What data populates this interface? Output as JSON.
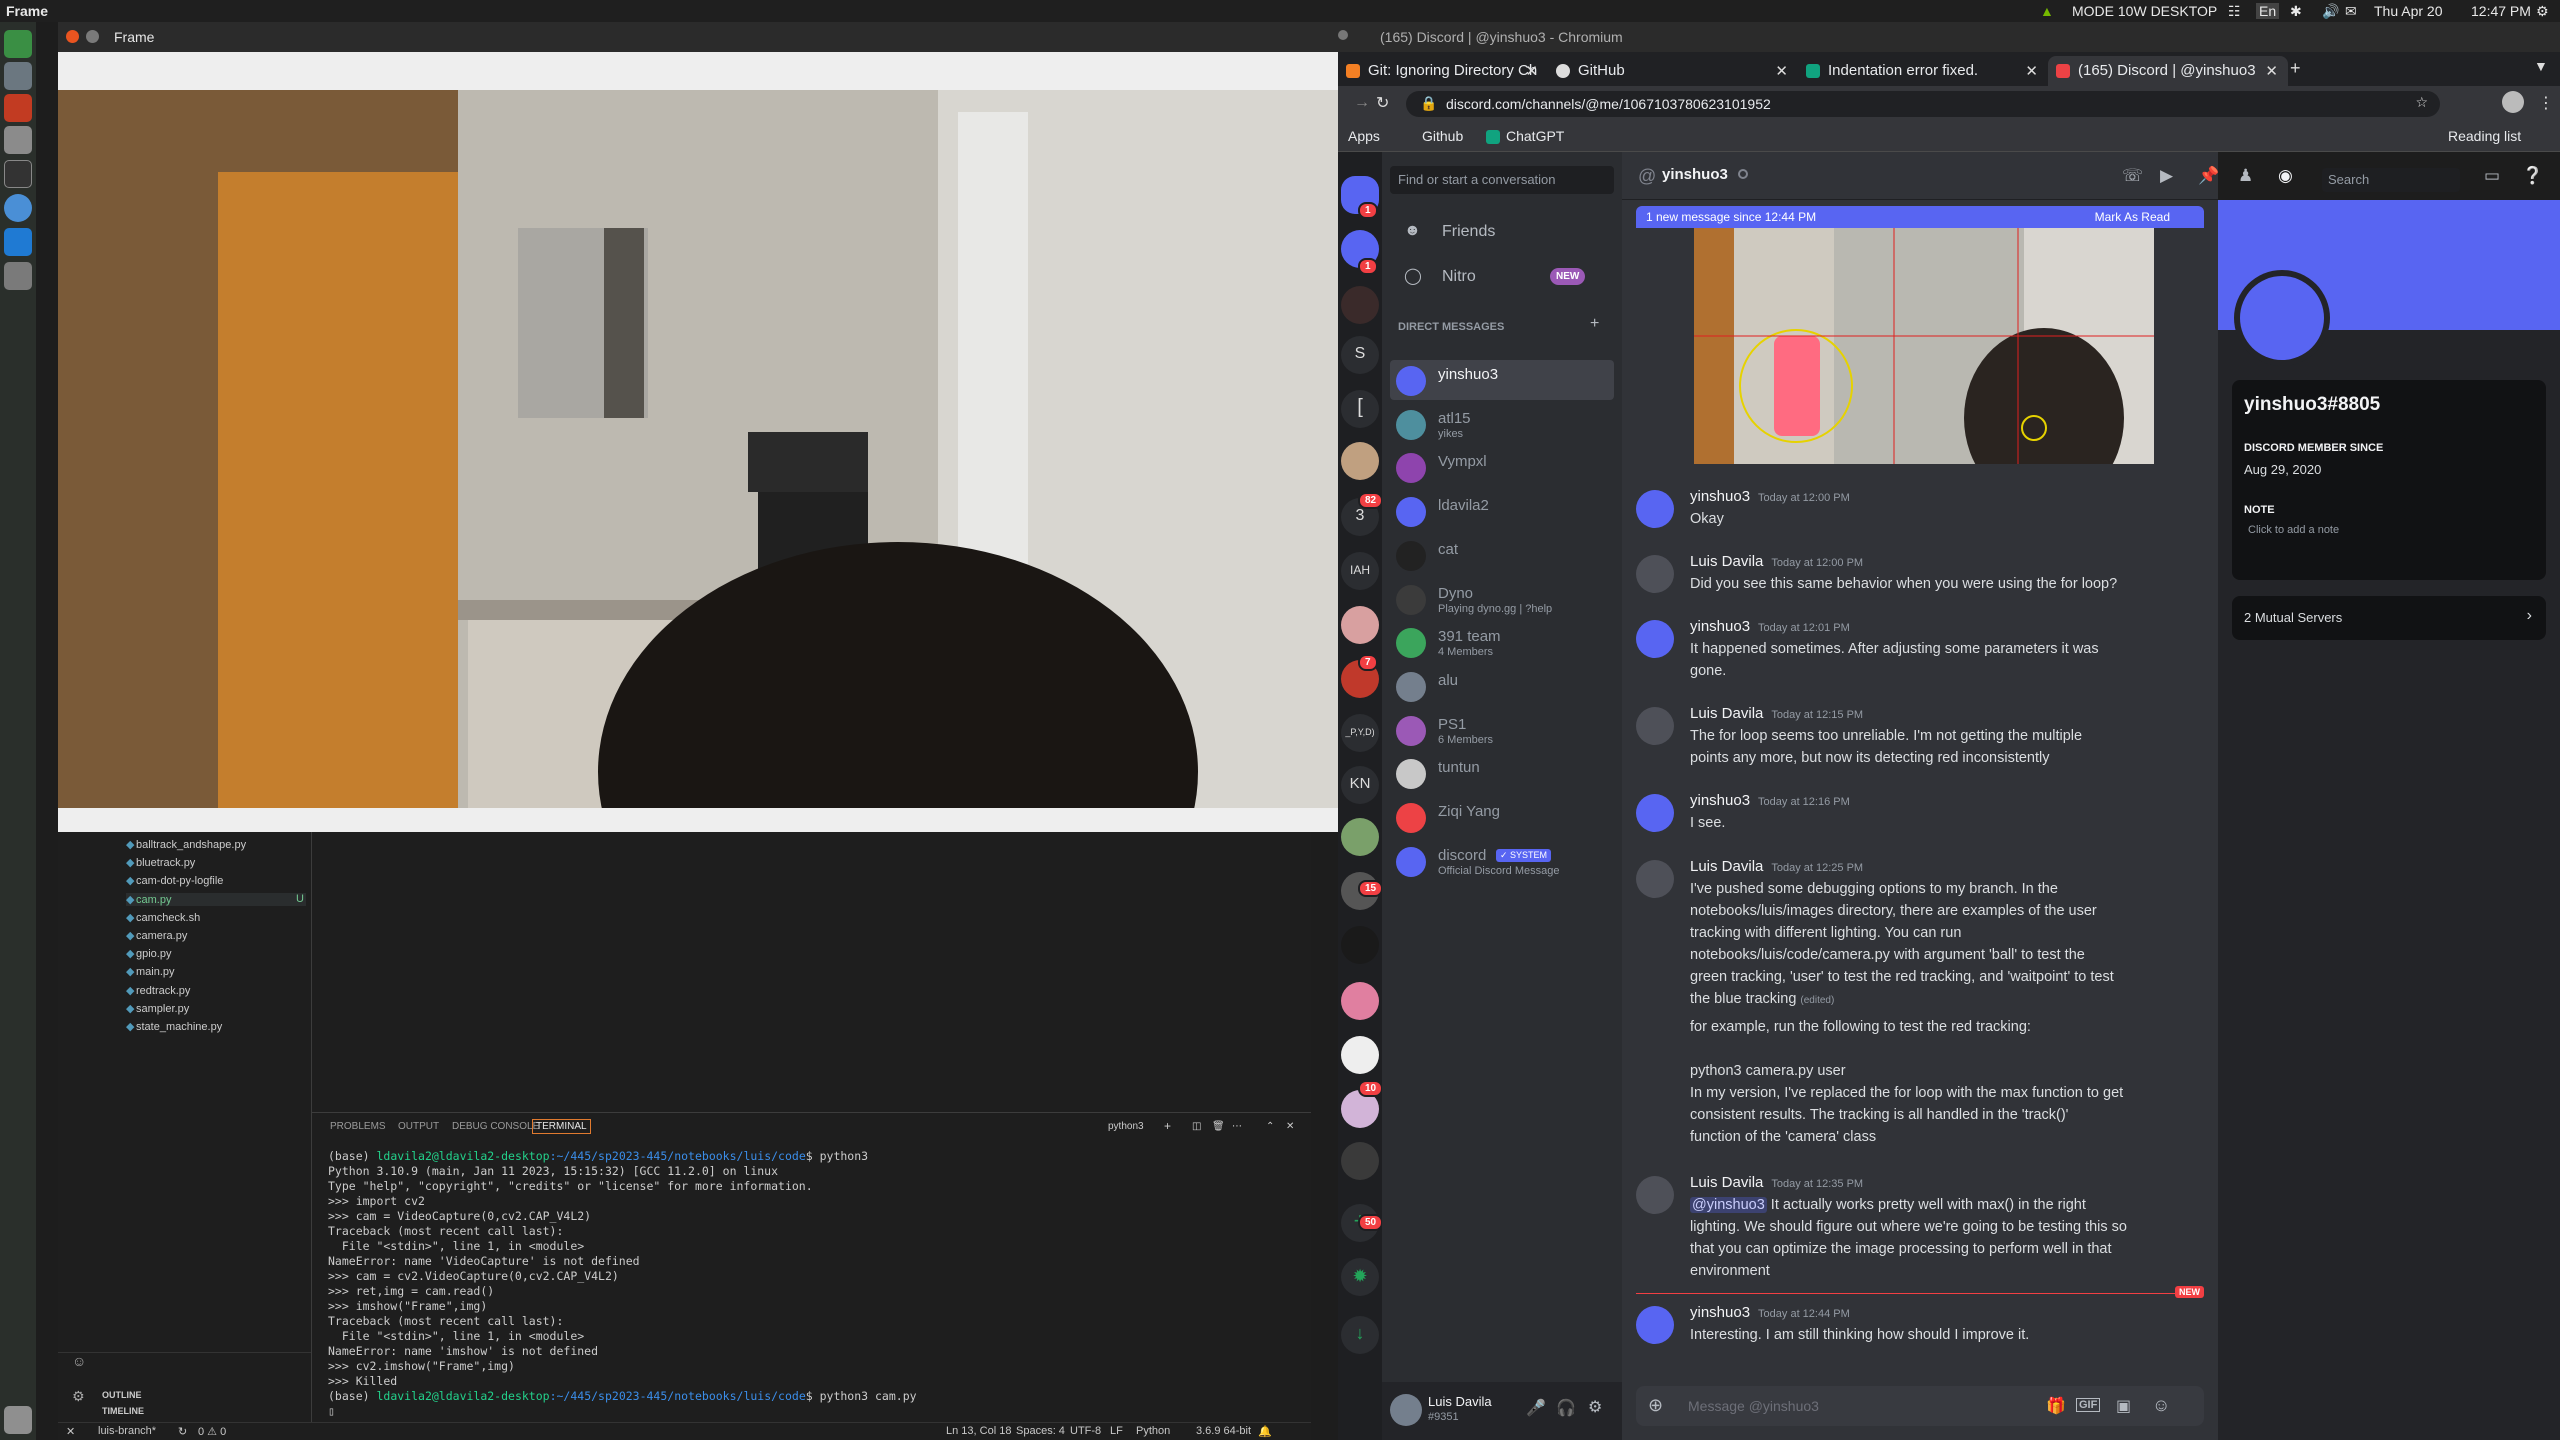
{
  "topbar": {
    "app": "Frame",
    "mode": "MODE 10W DESKTOP",
    "lang": "En",
    "datetime": "Thu Apr 20",
    "time": "12:47 PM"
  },
  "frame_window": {
    "title": "Frame"
  },
  "chromium": {
    "window_title": "(165) Discord | @yinshuo3 - Chromium",
    "tabs": [
      {
        "label": "Git: Ignoring Directory Ch"
      },
      {
        "label": "GitHub"
      },
      {
        "label": "Indentation error fixed."
      },
      {
        "label": "(165) Discord | @yinshuo3"
      }
    ],
    "url": "discord.com/channels/@me/1067103780623101952",
    "bookmarks": [
      "Apps",
      "Github",
      "ChatGPT"
    ],
    "reading_list": "Reading list"
  },
  "vscode": {
    "files": [
      "balltrack_andshape.py",
      "bluetrack.py",
      "cam-dot-py-logfile",
      "cam.py",
      "camcheck.sh",
      "camera.py",
      "gpio.py",
      "main.py",
      "redtrack.py",
      "sampler.py",
      "state_machine.py"
    ],
    "modified_marker": "U",
    "outline": "OUTLINE",
    "timeline": "TIMELINE",
    "panel_tabs": [
      "PROBLEMS",
      "OUTPUT",
      "DEBUG CONSOLE",
      "TERMINAL"
    ],
    "terminal_shell": "python3",
    "prompt_user": "ldavila2@ldavila2-desktop",
    "prompt_path": ":~/445/sp2023-445/notebooks/luis/code",
    "cmd1": "$ python3",
    "cmd2": "$ python3 cam.py",
    "env": "(base)",
    "lines": [
      "Python 3.10.9 (main, Jan 11 2023, 15:15:32) [GCC 11.2.0] on linux",
      "Type \"help\", \"copyright\", \"credits\" or \"license\" for more information.",
      ">>> import cv2",
      ">>> cam = VideoCapture(0,cv2.CAP_V4L2)",
      "Traceback (most recent call last):",
      "  File \"<stdin>\", line 1, in <module>",
      "NameError: name 'VideoCapture' is not defined",
      ">>> cam = cv2.VideoCapture(0,cv2.CAP_V4L2)",
      ">>> ret,img = cam.read()",
      ">>> imshow(\"Frame\",img)",
      "Traceback (most recent call last):",
      "  File \"<stdin>\", line 1, in <module>",
      "NameError: name 'imshow' is not defined",
      ">>> cv2.imshow(\"Frame\",img)",
      ">>> Killed"
    ],
    "status": {
      "branch": "luis-branch*",
      "problems": "0 ⚠ 0",
      "position": "Ln 13, Col 18",
      "spaces": "Spaces: 4",
      "encoding": "UTF-8",
      "eol": "LF",
      "language": "Python",
      "interpreter": "3.6.9 64-bit"
    }
  },
  "discord": {
    "search_placeholder": "Find or start a conversation",
    "friends": "Friends",
    "nitro": "Nitro",
    "nitro_badge": "NEW",
    "dm_header": "DIRECT MESSAGES",
    "dms": [
      {
        "name": "yinshuo3",
        "sub": "",
        "color": "#5865f2"
      },
      {
        "name": "atl15",
        "sub": "yikes",
        "color": "#4e8f9e"
      },
      {
        "name": "Vympxl",
        "sub": "",
        "color": "#8e44ad"
      },
      {
        "name": "ldavila2",
        "sub": "",
        "color": "#5865f2"
      },
      {
        "name": "cat",
        "sub": "",
        "color": "#222222"
      },
      {
        "name": "Dyno",
        "sub": "Playing dyno.gg | ?help",
        "color": "#3b3b3b"
      },
      {
        "name": "391 team",
        "sub": "4 Members",
        "color": "#3ba55c"
      },
      {
        "name": "alu",
        "sub": "",
        "color": "#747f8d"
      },
      {
        "name": "PS1",
        "sub": "6 Members",
        "color": "#9b59b6"
      },
      {
        "name": "tuntun",
        "sub": "",
        "color": "#c8c8c8"
      },
      {
        "name": "Ziqi Yang",
        "sub": "",
        "color": "#ed4245"
      },
      {
        "name": "discord",
        "sub": "Official Discord Message",
        "color": "#5865f2",
        "badge": "✓ SYSTEM"
      }
    ],
    "server_badges": [
      "1",
      "1",
      "82",
      "7",
      "15",
      "10",
      "50"
    ],
    "server_labels": [
      "S",
      "[",
      "3",
      "IAH",
      "_P,Y,D)",
      "KN"
    ],
    "me": {
      "name": "Luis Davila",
      "tag": "#9351"
    },
    "chat_header": "yinshuo3",
    "header_search": "Search",
    "new_bar": "1 new message since 12:44 PM",
    "mark_read": "Mark As Read",
    "messages": [
      {
        "author": "yinshuo3",
        "time": "Today at 12:00 PM",
        "lines": [
          "Okay"
        ]
      },
      {
        "author": "Luis Davila",
        "time": "Today at 12:00 PM",
        "lines": [
          "Did you see this same behavior when you were using the for loop?"
        ]
      },
      {
        "author": "yinshuo3",
        "time": "Today at 12:01 PM",
        "lines": [
          "It happened sometimes. After adjusting some parameters it was",
          "gone."
        ]
      },
      {
        "author": "Luis Davila",
        "time": "Today at 12:15 PM",
        "lines": [
          "The for loop seems too unreliable. I'm not getting the multiple",
          "points any more, but now its detecting red inconsistently"
        ]
      },
      {
        "author": "yinshuo3",
        "time": "Today at 12:16 PM",
        "lines": [
          "I see."
        ]
      },
      {
        "author": "Luis Davila",
        "time": "Today at 12:25 PM",
        "lines": [
          "I've pushed some debugging options to my branch. In the",
          "notebooks/luis/images directory, there are examples of the user",
          "tracking with different lighting. You can run",
          "notebooks/luis/code/camera.py with argument 'ball' to test the",
          "green tracking, 'user' to test the red tracking, and 'waitpoint' to test",
          "the blue tracking"
        ],
        "edited": "(edited)",
        "extra": [
          "for example, run the following to test the red tracking:",
          "",
          "python3 camera.py user",
          "In my version, I've replaced the for loop with the max function to get",
          "consistent results. The tracking is all handled in the 'track()'",
          "function of the 'camera' class"
        ]
      },
      {
        "author": "Luis Davila",
        "time": "Today at 12:35 PM",
        "mention": "@yinshuo3",
        "lines": [
          " It actually works pretty well with max() in the right",
          "lighting. We should figure out where we're going to be testing this so",
          "that you can optimize the image processing to perform well in that",
          "environment"
        ]
      },
      {
        "author": "yinshuo3",
        "time": "Today at 12:44 PM",
        "lines": [
          "Interesting. I am still thinking how should I improve it."
        ]
      }
    ],
    "new_label": "NEW",
    "input_placeholder": "Message @yinshuo3",
    "gif": "GIF",
    "profile": {
      "username": "yinshuo3#8805",
      "member_since_label": "DISCORD MEMBER SINCE",
      "member_since": "Aug 29, 2020",
      "note_label": "NOTE",
      "note_placeholder": "Click to add a note",
      "mutual": "2 Mutual Servers"
    }
  }
}
